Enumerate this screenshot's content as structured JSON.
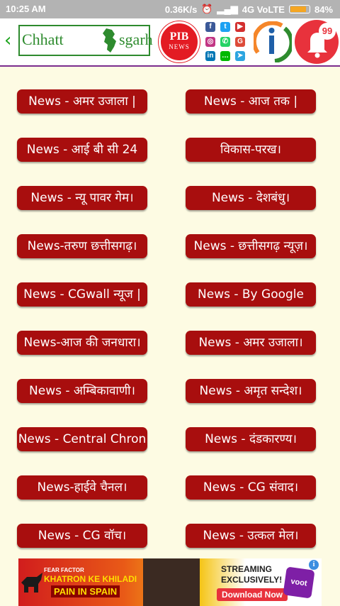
{
  "status_bar": {
    "time": "10:25 AM",
    "speed": "0.36K/s",
    "network": "4G VoLTE",
    "battery": "84%",
    "battery_level": 0.84
  },
  "header": {
    "logo_part1": "Chhatt",
    "logo_part2": "sgarh",
    "pib_line1": "PIB",
    "pib_line2": "NEWS",
    "notification_count": "99",
    "social_icons": [
      "facebook-icon",
      "twitter-icon",
      "youtube-icon",
      "instagram-icon",
      "whatsapp-icon",
      "googleplus-icon",
      "linkedin-icon",
      "line-icon",
      "telegram-icon"
    ],
    "colors": {
      "accent": "#7b2d8e",
      "button": "#a80e0e",
      "background": "#fdfbe3"
    }
  },
  "news_buttons": [
    "News - अमर उजाला |",
    "News - आज तक |",
    "News - आई बी सी 24",
    "विकास-परख।",
    "News - न्यू पावर गेम।",
    "News - देशबंधु।",
    "News-तरुण छत्तीसगढ़।",
    "News - छत्तीसगढ़ न्यूज़।",
    "News - CGwall न्यूज |",
    "News - By Google",
    "News-आज की जनधारा।",
    "News - अमर उजाला।",
    "News - अम्बिकावाणी।",
    "News - अमृत सन्देश।",
    "News - Central Chron",
    "News - दंडकारण्य।",
    "News-हाईवे चैनल।",
    "News - CG संवाद।",
    "News - CG वॉच।",
    "News - उत्कल मेल।"
  ],
  "ad": {
    "brand_line1": "FEAR FACTOR",
    "brand_line2": "KHATRON KE KHILADI",
    "tagline": "PAIN IN SPAIN",
    "streaming": "STREAMING",
    "exclusively": "EXCLUSIVELY!",
    "cta": "Download Now",
    "app": "voot"
  }
}
